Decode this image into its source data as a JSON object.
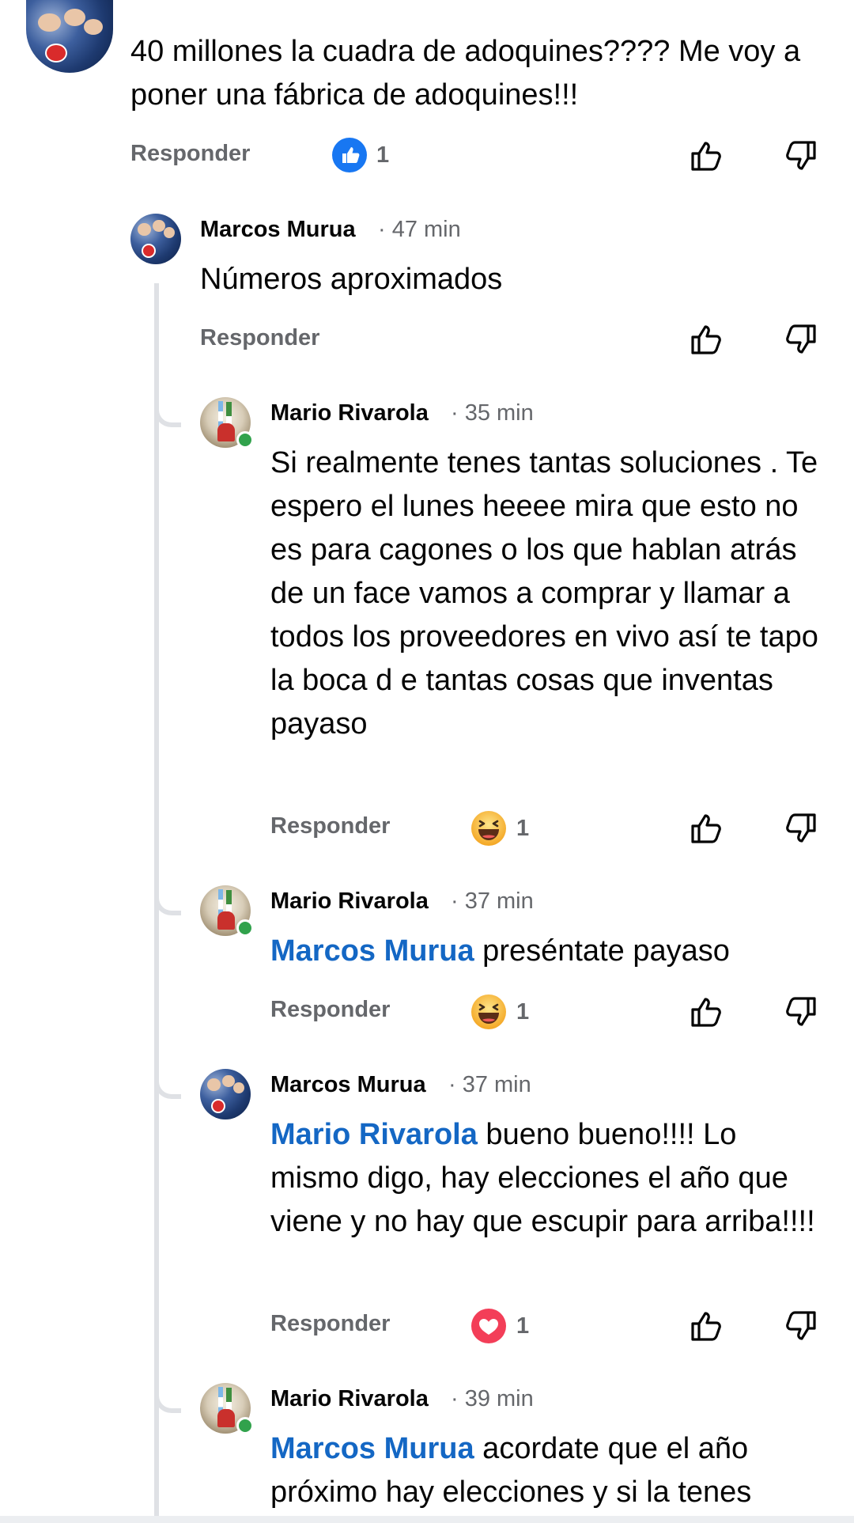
{
  "top_comment": {
    "text": "40 millones la cuadra de adoquines???? Me voy a poner una fábrica de adoquines!!!",
    "reply_label": "Responder",
    "reaction": {
      "type": "like",
      "count": "1"
    }
  },
  "replies": [
    {
      "author": "Marcos Murua",
      "time": "· 47 min",
      "text": "Números aproximados",
      "reply_label": "Responder"
    },
    {
      "author": "Mario Rivarola",
      "time": "· 35 min",
      "text": "Si realmente tenes tantas soluciones . Te espero el lunes heeee mira que esto no es para cagones o los que hablan atrás de un face vamos a comprar y llamar a todos los proveedores en vivo así te tapo la boca d e tantas cosas que inventas payaso",
      "reply_label": "Responder",
      "reaction": {
        "type": "haha",
        "count": "1"
      }
    },
    {
      "author": "Mario Rivarola",
      "time": "· 37 min",
      "mention": "Marcos Murua",
      "text": " preséntate payaso",
      "reply_label": "Responder",
      "reaction": {
        "type": "haha",
        "count": "1"
      }
    },
    {
      "author": "Marcos Murua",
      "time": "· 37 min",
      "mention": "Mario Rivarola",
      "text": " bueno bueno!!!! Lo mismo digo, hay elecciones el año que viene y no hay que escupir para arriba!!!!",
      "reply_label": "Responder",
      "reaction": {
        "type": "love",
        "count": "1"
      }
    },
    {
      "author": "Mario Rivarola",
      "time": "· 39 min",
      "mention": "Marcos Murua",
      "text": " acordate que el año próximo hay elecciones y si la tenes"
    }
  ],
  "icons": {
    "like_reaction": "like-reaction-icon",
    "haha_reaction": "haha-reaction-icon",
    "love_reaction": "love-reaction-icon",
    "upvote": "thumbs-up-outline-icon",
    "downvote": "thumbs-down-outline-icon"
  },
  "colors": {
    "mention": "#1467c4",
    "secondary_text": "#65676b",
    "like_blue": "#1877f2",
    "love_red": "#f33e58",
    "haha_yellow": "#f7b928",
    "online_green": "#31a24c"
  }
}
